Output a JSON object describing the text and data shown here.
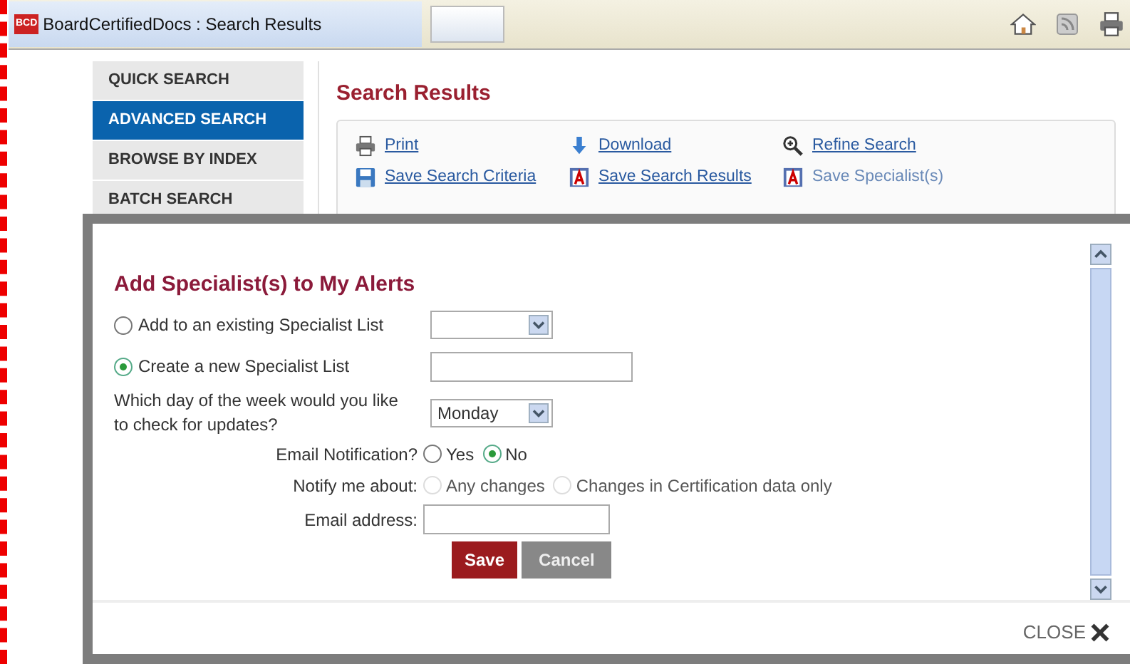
{
  "browser": {
    "tab_title": "BoardCertifiedDocs : Search Results",
    "favicon": "BCD"
  },
  "sidebar": {
    "items": [
      {
        "label": "QUICK SEARCH",
        "selected": false
      },
      {
        "label": "ADVANCED SEARCH",
        "selected": true
      },
      {
        "label": "BROWSE BY INDEX",
        "selected": false
      },
      {
        "label": "BATCH SEARCH",
        "selected": false
      }
    ]
  },
  "main": {
    "title": "Search Results",
    "actions": [
      {
        "label": "Print",
        "disabled": false
      },
      {
        "label": "Download",
        "disabled": false
      },
      {
        "label": "Refine Search",
        "disabled": false
      },
      {
        "label": "Save Search Criteria",
        "disabled": false
      },
      {
        "label": "Save Search Results",
        "disabled": false
      },
      {
        "label": "Save Specialist(s)",
        "disabled": true
      }
    ]
  },
  "modal": {
    "title": "Add Specialist(s) to My Alerts",
    "list_options": [
      {
        "label": "Add to an existing Specialist List",
        "selected": false
      },
      {
        "label": "Create a new Specialist List",
        "selected": true
      }
    ],
    "day_question": "Which day of the week would you like to check for updates?",
    "day_value": "Monday",
    "email_notification": {
      "label": "Email Notification?",
      "options": [
        {
          "label": "Yes",
          "selected": false
        },
        {
          "label": "No",
          "selected": true
        }
      ]
    },
    "notify": {
      "label": "Notify me about:",
      "disabled": true,
      "options": [
        {
          "label": "Any changes",
          "selected": false
        },
        {
          "label": "Changes in Certification data only",
          "selected": false
        }
      ]
    },
    "email_label": "Email address:",
    "buttons": [
      {
        "label": "Save",
        "kind": "primary"
      },
      {
        "label": "Cancel",
        "kind": "secondary"
      }
    ],
    "close_label": "CLOSE"
  }
}
